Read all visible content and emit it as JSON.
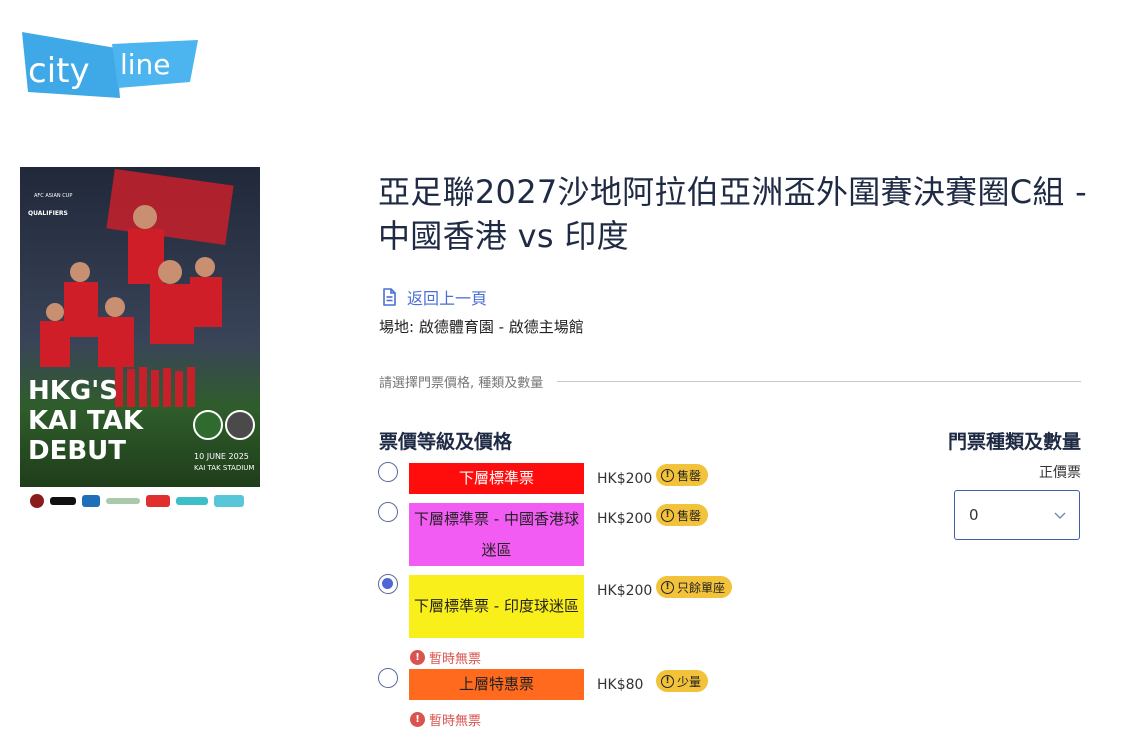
{
  "logo": {
    "text_city": "city",
    "text_line": "line"
  },
  "poster": {
    "badge_text": "AFC ASIAN CUP",
    "qualifier_text": "QUALIFIERS",
    "headline": [
      "HKG'S",
      "KAI TAK",
      "DEBUT"
    ],
    "date_text": "10 JUNE 2025",
    "stadium_text": "KAI TAK STADIUM"
  },
  "event": {
    "title": "亞足聯2027沙地阿拉伯亞洲盃外圍賽決賽圈C組 - 中國香港 vs 印度",
    "back_link": "返回上一頁",
    "venue": "場地:  啟德體育園 - 啟德主場館"
  },
  "selection": {
    "prompt": "請選擇門票價格, 種類及數量",
    "price_heading": "票價等級及價格",
    "type_heading": "門票種類及數量",
    "type_label": "正價票",
    "quantity_value": "0"
  },
  "tickets": [
    {
      "label": "下層標準票",
      "price": "HK$200",
      "badge": "售罄",
      "color": "#ff0d0d",
      "text_color": "#ffffff",
      "checked": false
    },
    {
      "label": "下層標準票 - 中國香港球迷區",
      "price": "HK$200",
      "badge": "售罄",
      "color": "#f25cf2",
      "text_color": "#222222",
      "checked": false
    },
    {
      "label": "下層標準票 - 印度球迷區",
      "price": "HK$200",
      "badge": "只餘單座",
      "color": "#f9ef1a",
      "text_color": "#222222",
      "checked": true,
      "status": "暫時無票"
    },
    {
      "label": "上層特惠票",
      "price": "HK$80",
      "badge": "少量",
      "color": "#ff6a1f",
      "text_color": "#222222",
      "checked": false,
      "status": "暫時無票"
    }
  ]
}
